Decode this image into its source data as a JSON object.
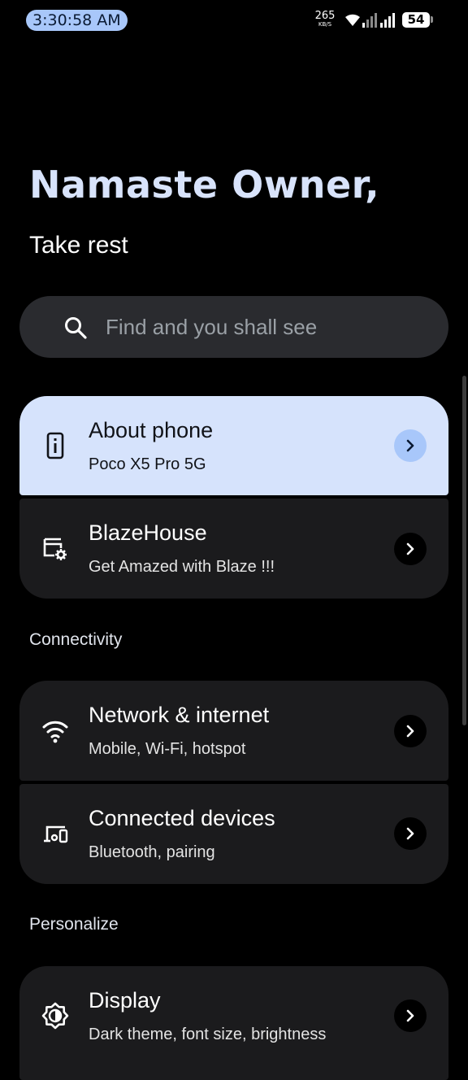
{
  "status_bar": {
    "time": "3:30:58 AM",
    "net_speed": "265",
    "net_speed_unit": "KB/S",
    "battery": "54"
  },
  "header": {
    "greeting": "Namaste Owner,",
    "subtitle": "Take rest"
  },
  "search": {
    "placeholder": "Find and you shall see"
  },
  "items": [
    {
      "title": "About phone",
      "summary": "Poco X5 Pro 5G",
      "icon": "phone-info-icon"
    },
    {
      "title": "BlazeHouse",
      "summary": "Get Amazed with Blaze !!!",
      "icon": "settings-gear-icon"
    },
    {
      "title": "Network & internet",
      "summary": "Mobile, Wi-Fi, hotspot",
      "icon": "wifi-icon"
    },
    {
      "title": "Connected devices",
      "summary": "Bluetooth, pairing",
      "icon": "devices-icon"
    },
    {
      "title": "Display",
      "summary": "Dark theme, font size, brightness",
      "icon": "brightness-icon"
    }
  ],
  "sections": {
    "connectivity": "Connectivity",
    "personalize": "Personalize"
  },
  "colors": {
    "accent": "#a8c7fa",
    "highlight_card": "#d6e3fc",
    "card": "#1b1b1d",
    "background": "#000000"
  }
}
